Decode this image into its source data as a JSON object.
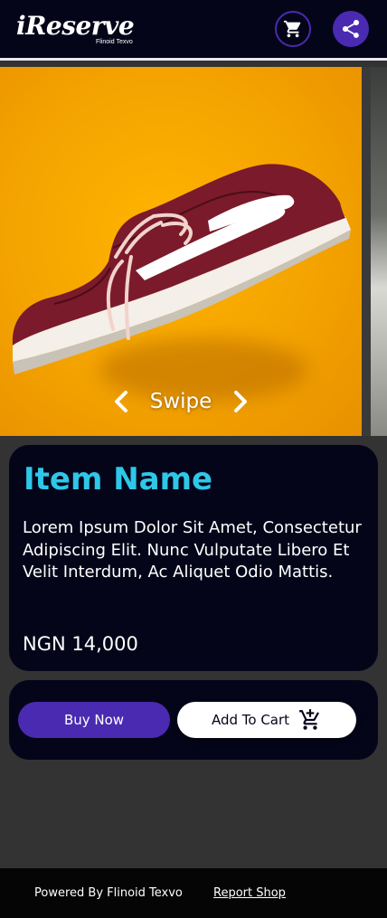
{
  "header": {
    "logo_text": "iReserve",
    "logo_subtitle": "Flinoid Texvo"
  },
  "carousel": {
    "swipe_label": "Swipe"
  },
  "product": {
    "name": "Item Name",
    "description": "Lorem Ipsum Dolor Sit Amet, Consectetur Adipiscing Elit. Nunc Vulputate Libero Et Velit Interdum, Ac Aliquet Odio Mattis.",
    "price": "NGN 14,000"
  },
  "actions": {
    "buy_now_label": "Buy Now",
    "add_to_cart_label": "Add To Cart"
  },
  "footer": {
    "powered_by": "Powered By Flinoid Texvo",
    "report_link": "Report Shop"
  },
  "icons": {
    "cart": "cart-icon",
    "share": "share-icon",
    "prev": "chevron-left-icon",
    "next": "chevron-right-icon",
    "add_cart": "cart-plus-icon"
  },
  "colors": {
    "header_bg": "#05051a",
    "accent_purple": "#4a2ab0",
    "item_name_cyan": "#2ec7e8",
    "slide_orange": "#f4a300",
    "page_bg": "#333333"
  }
}
